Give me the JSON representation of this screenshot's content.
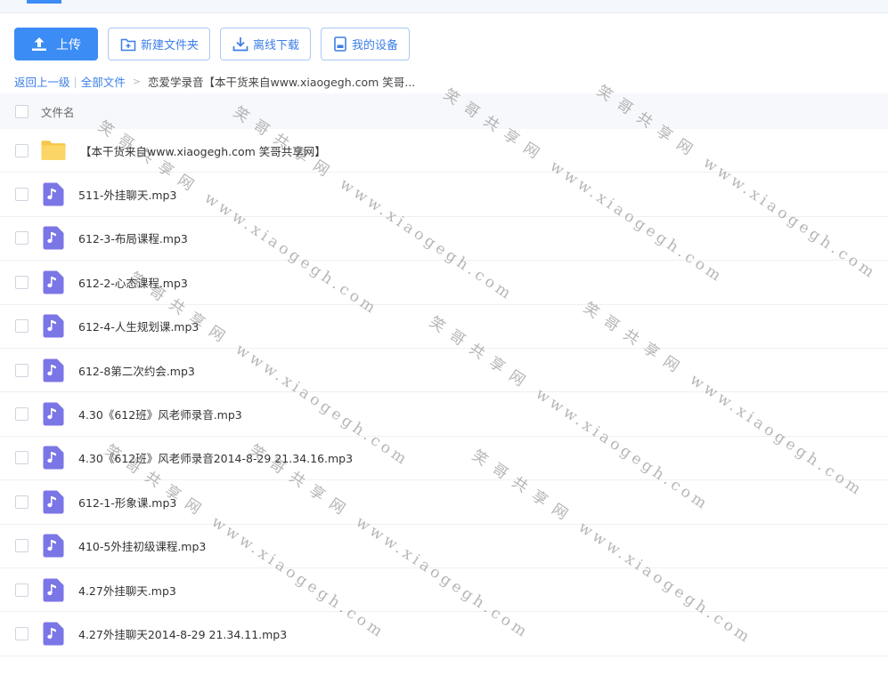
{
  "toolbar": {
    "upload_label": "上传",
    "new_folder_label": "新建文件夹",
    "offline_download_label": "离线下载",
    "my_devices_label": "我的设备"
  },
  "breadcrumb": {
    "back": "返回上一级",
    "separator": "|",
    "all_files": "全部文件",
    "arrow": ">",
    "current": "恋爱学录音【本干货来自www.xiaogegh.com 笑哥..."
  },
  "list": {
    "header_label": "文件名",
    "items": [
      {
        "name": "【本干货来自www.xiaogegh.com 笑哥共享网】",
        "type": "folder"
      },
      {
        "name": "511-外挂聊天.mp3",
        "type": "audio"
      },
      {
        "name": "612-3-布局课程.mp3",
        "type": "audio"
      },
      {
        "name": "612-2-心态课程.mp3",
        "type": "audio"
      },
      {
        "name": "612-4-人生规划课.mp3",
        "type": "audio"
      },
      {
        "name": "612-8第二次约会.mp3",
        "type": "audio"
      },
      {
        "name": "4.30《612班》风老师录音.mp3",
        "type": "audio"
      },
      {
        "name": "4.30《612班》风老师录音2014-8-29 21.34.16.mp3",
        "type": "audio"
      },
      {
        "name": "612-1-形象课.mp3",
        "type": "audio"
      },
      {
        "name": "410-5外挂初级课程.mp3",
        "type": "audio"
      },
      {
        "name": "4.27外挂聊天.mp3",
        "type": "audio"
      },
      {
        "name": "4.27外挂聊天2014-8-29 21.34.11.mp3",
        "type": "audio"
      }
    ]
  },
  "watermark": {
    "site_name": "笑哥共享网",
    "url": "www.xiaogegh.com"
  },
  "colors": {
    "accent": "#3b8cf5",
    "folder": "#f7c64a",
    "audio_icon": "#7b76e6"
  }
}
